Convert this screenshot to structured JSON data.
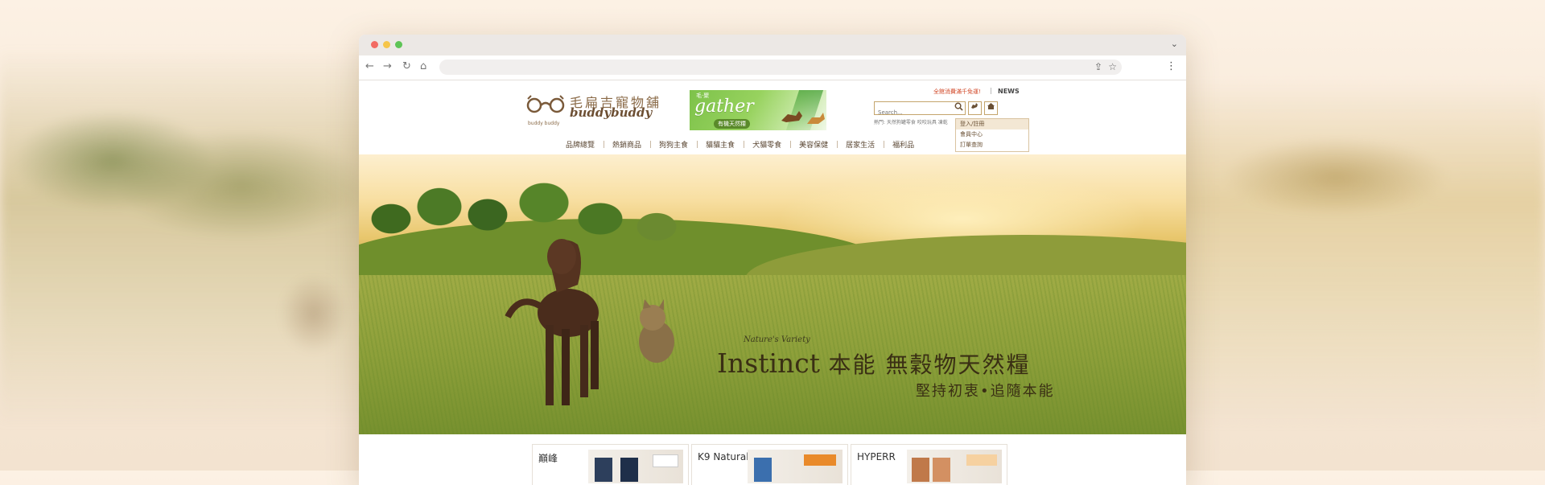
{
  "browser": {
    "url": "",
    "back_icon": "←",
    "forward_icon": "→",
    "reload_icon": "↻",
    "home_icon": "⌂",
    "share_icon": "⇪",
    "bookmark_icon": "☆",
    "menu_icon": "⋮",
    "chevron_icon": "⌄"
  },
  "header": {
    "logo_cn": "毛扁吉寵物舖",
    "logo_en": "buddybuddy",
    "logo_sub": "buddy buddy",
    "banner_small": "毛·聚",
    "banner_title": "gather",
    "banner_pill": "有機天然糧",
    "promo": "全館消費滿千免運!",
    "separator": "|",
    "news": "NEWS",
    "search_placeholder": "Search...",
    "search_icon": "🔍",
    "dog_icon": "🐕",
    "house_icon": "🏠",
    "hot_label": "熱門: 天然狗罐零食  咬咬玩具  凍乾"
  },
  "account_menu": {
    "items": [
      "登入/註冊",
      "會員中心",
      "訂單查詢"
    ]
  },
  "nav": {
    "items": [
      "品牌總覽",
      "熱銷商品",
      "狗狗主食",
      "貓貓主食",
      "犬貓零食",
      "美容保健",
      "居家生活",
      "福利品"
    ]
  },
  "hero": {
    "brand_small": "Nature's Variety",
    "headline_en": "Instinct",
    "headline_cn": "本能 無穀物天然糧",
    "tagline": "堅持初衷•追隨本能"
  },
  "brands": [
    {
      "name": "巔峰"
    },
    {
      "name": "K9 Natural"
    },
    {
      "name": "HYPERR"
    }
  ]
}
